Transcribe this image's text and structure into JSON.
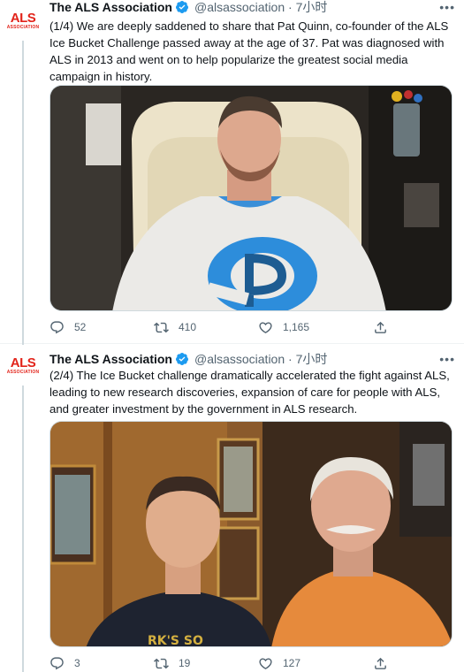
{
  "tweets": [
    {
      "author_name": "The ALS Association",
      "handle_time": "@alsassociation · 7小时",
      "more": "•••",
      "text": "(1/4) We are deeply saddened to share that Pat Quinn, co-founder of the ALS Ice Bucket Challenge passed away at the age of 37. Pat was diagnosed with ALS in 2013 and went on to help popularize the greatest social media campaign in history.",
      "replies": "52",
      "retweets": "410",
      "likes": "1,165"
    },
    {
      "author_name": "The ALS Association",
      "handle_time": "@alsassociation · 7小时",
      "more": "•••",
      "text": "(2/4) The Ice Bucket challenge dramatically accelerated the fight against ALS, leading to new research discoveries, expansion of care for people with ALS, and greater investment by the government in ALS research.",
      "replies": "3",
      "retweets": "19",
      "likes": "127"
    }
  ],
  "avatar": {
    "logo": "ALS",
    "sub": "ASSOCIATION"
  },
  "colors": {
    "brand_red": "#e2231a",
    "verified_blue": "#1d9bf0",
    "muted": "#536471"
  },
  "icons": [
    "reply-icon",
    "retweet-icon",
    "like-icon",
    "share-icon",
    "verified-icon",
    "more-icon"
  ]
}
